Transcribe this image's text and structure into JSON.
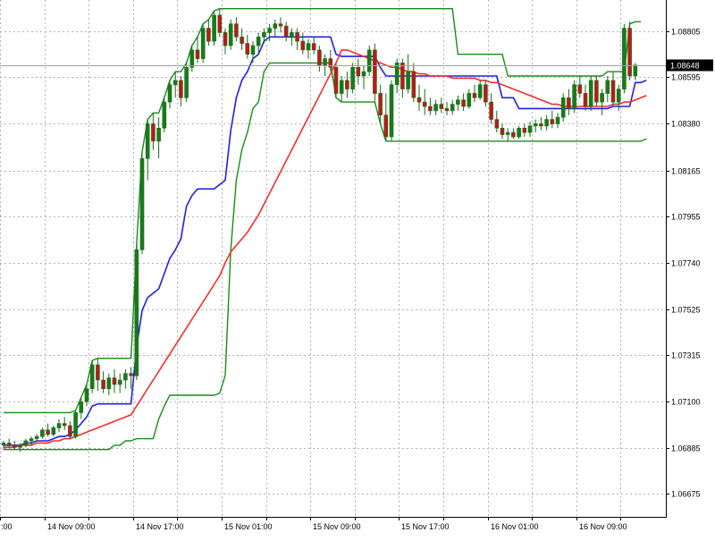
{
  "chart_data": {
    "type": "candlestick",
    "title": "",
    "grid": true,
    "ylim": [
      1.0657,
      1.0895
    ],
    "y_ticks": [
      "1.08805",
      "1.08595",
      "1.08380",
      "1.08165",
      "1.07955",
      "1.07740",
      "1.07525",
      "1.07315",
      "1.07100",
      "1.06885",
      "1.06675"
    ],
    "x_ticks": [
      "14 Nov 09:00",
      "14 Nov 17:00",
      "15 Nov 01:00",
      "15 Nov 09:00",
      "15 Nov 17:00",
      "16 Nov 01:00",
      "16 Nov 09:00"
    ],
    "x_tick_first_partial": ":00",
    "current_price": "1.08648",
    "bars_per_tick": 8,
    "ohlc": [
      [
        1.069,
        1.0692,
        1.0688,
        1.0691
      ],
      [
        1.0691,
        1.0693,
        1.0689,
        1.069
      ],
      [
        1.069,
        1.0692,
        1.0688,
        1.0689
      ],
      [
        1.0689,
        1.0691,
        1.0687,
        1.069
      ],
      [
        1.069,
        1.0693,
        1.0689,
        1.0692
      ],
      [
        1.0692,
        1.0694,
        1.069,
        1.0693
      ],
      [
        1.0693,
        1.0695,
        1.0692,
        1.0694
      ],
      [
        1.0694,
        1.0698,
        1.0693,
        1.0697
      ],
      [
        1.0697,
        1.07,
        1.0694,
        1.0695
      ],
      [
        1.0695,
        1.0699,
        1.0694,
        1.0698
      ],
      [
        1.0698,
        1.0702,
        1.0696,
        1.07
      ],
      [
        1.07,
        1.0703,
        1.0697,
        1.0699
      ],
      [
        1.0699,
        1.0701,
        1.0693,
        1.0694
      ],
      [
        1.0694,
        1.0706,
        1.0693,
        1.0705
      ],
      [
        1.0705,
        1.0712,
        1.0702,
        1.071
      ],
      [
        1.071,
        1.0718,
        1.0708,
        1.0716
      ],
      [
        1.0716,
        1.0729,
        1.0714,
        1.0727
      ],
      [
        1.0727,
        1.073,
        1.0715,
        1.072
      ],
      [
        1.072,
        1.0724,
        1.0714,
        1.0716
      ],
      [
        1.0716,
        1.0723,
        1.0713,
        1.0721
      ],
      [
        1.0721,
        1.0725,
        1.0714,
        1.0718
      ],
      [
        1.0718,
        1.0723,
        1.0714,
        1.072
      ],
      [
        1.072,
        1.0725,
        1.0716,
        1.0723
      ],
      [
        1.0723,
        1.0726,
        1.0716,
        1.0722
      ],
      [
        1.0722,
        1.0782,
        1.072,
        1.078
      ],
      [
        1.078,
        1.0825,
        1.0778,
        1.0822
      ],
      [
        1.0822,
        1.084,
        1.0812,
        1.0838
      ],
      [
        1.0838,
        1.0843,
        1.0826,
        1.083
      ],
      [
        1.083,
        1.0841,
        1.0822,
        1.0836
      ],
      [
        1.0836,
        1.085,
        1.0834,
        1.0848
      ],
      [
        1.0848,
        1.0858,
        1.0845,
        1.0856
      ],
      [
        1.0856,
        1.0862,
        1.085,
        1.0858
      ],
      [
        1.0858,
        1.086,
        1.0846,
        1.085
      ],
      [
        1.085,
        1.0866,
        1.0848,
        1.0864
      ],
      [
        1.0864,
        1.0874,
        1.0862,
        1.0872
      ],
      [
        1.0872,
        1.0878,
        1.0866,
        1.0868
      ],
      [
        1.0868,
        1.0884,
        1.0866,
        1.0882
      ],
      [
        1.0882,
        1.0886,
        1.0874,
        1.0876
      ],
      [
        1.0876,
        1.089,
        1.0874,
        1.0888
      ],
      [
        1.0888,
        1.0891,
        1.0878,
        1.088
      ],
      [
        1.088,
        1.0882,
        1.087,
        1.0874
      ],
      [
        1.0874,
        1.0886,
        1.0872,
        1.0884
      ],
      [
        1.0884,
        1.0887,
        1.0876,
        1.0878
      ],
      [
        1.0878,
        1.0882,
        1.0872,
        1.0875
      ],
      [
        1.0875,
        1.0879,
        1.0868,
        1.087
      ],
      [
        1.087,
        1.0876,
        1.0866,
        1.0874
      ],
      [
        1.0874,
        1.088,
        1.087,
        1.0878
      ],
      [
        1.0878,
        1.0882,
        1.0875,
        1.088
      ],
      [
        1.088,
        1.0884,
        1.0876,
        1.0882
      ],
      [
        1.0882,
        1.0886,
        1.0878,
        1.0884
      ],
      [
        1.0884,
        1.0887,
        1.088,
        1.0883
      ],
      [
        1.0883,
        1.0885,
        1.0876,
        1.0878
      ],
      [
        1.0878,
        1.0882,
        1.0874,
        1.088
      ],
      [
        1.088,
        1.0882,
        1.0872,
        1.0876
      ],
      [
        1.0876,
        1.088,
        1.087,
        1.0872
      ],
      [
        1.0872,
        1.0877,
        1.0868,
        1.0875
      ],
      [
        1.0875,
        1.0878,
        1.087,
        1.0872
      ],
      [
        1.0872,
        1.0874,
        1.0862,
        1.0865
      ],
      [
        1.0865,
        1.087,
        1.086,
        1.0868
      ],
      [
        1.0868,
        1.0872,
        1.0862,
        1.0864
      ],
      [
        1.0864,
        1.0866,
        1.085,
        1.0852
      ],
      [
        1.0852,
        1.086,
        1.0848,
        1.0858
      ],
      [
        1.0858,
        1.0862,
        1.085,
        1.0854
      ],
      [
        1.0854,
        1.0866,
        1.0852,
        1.0864
      ],
      [
        1.0864,
        1.0868,
        1.0856,
        1.086
      ],
      [
        1.086,
        1.0865,
        1.0854,
        1.0862
      ],
      [
        1.0862,
        1.0874,
        1.086,
        1.0872
      ],
      [
        1.0872,
        1.0875,
        1.0848,
        1.0852
      ],
      [
        1.0852,
        1.0856,
        1.0838,
        1.0842
      ],
      [
        1.0842,
        1.0852,
        1.083,
        1.0832
      ],
      [
        1.0832,
        1.0858,
        1.083,
        1.0856
      ],
      [
        1.0856,
        1.0868,
        1.0852,
        1.0866
      ],
      [
        1.0866,
        1.0868,
        1.085,
        1.0854
      ],
      [
        1.0854,
        1.087,
        1.0852,
        1.0862
      ],
      [
        1.0862,
        1.0866,
        1.0848,
        1.085
      ],
      [
        1.085,
        1.0856,
        1.0844,
        1.0848
      ],
      [
        1.0848,
        1.0854,
        1.0842,
        1.0846
      ],
      [
        1.0846,
        1.085,
        1.0842,
        1.0844
      ],
      [
        1.0844,
        1.0849,
        1.0842,
        1.0847
      ],
      [
        1.0847,
        1.085,
        1.0843,
        1.0845
      ],
      [
        1.0845,
        1.0848,
        1.0842,
        1.0844
      ],
      [
        1.0844,
        1.0849,
        1.0842,
        1.0847
      ],
      [
        1.0847,
        1.0851,
        1.0844,
        1.0849
      ],
      [
        1.0849,
        1.0852,
        1.0844,
        1.0846
      ],
      [
        1.0846,
        1.0854,
        1.0845,
        1.0852
      ],
      [
        1.0852,
        1.0856,
        1.0848,
        1.085
      ],
      [
        1.085,
        1.0858,
        1.0849,
        1.0856
      ],
      [
        1.0856,
        1.0858,
        1.0846,
        1.0848
      ],
      [
        1.0848,
        1.0852,
        1.0838,
        1.084
      ],
      [
        1.084,
        1.0844,
        1.0834,
        1.0836
      ],
      [
        1.0836,
        1.0838,
        1.0831,
        1.0833
      ],
      [
        1.0833,
        1.0836,
        1.083,
        1.0834
      ],
      [
        1.0834,
        1.0836,
        1.0831,
        1.0832
      ],
      [
        1.0832,
        1.0837,
        1.0831,
        1.0836
      ],
      [
        1.0836,
        1.0838,
        1.0832,
        1.0834
      ],
      [
        1.0834,
        1.0839,
        1.0832,
        1.0837
      ],
      [
        1.0837,
        1.084,
        1.0834,
        1.0838
      ],
      [
        1.0838,
        1.0841,
        1.0835,
        1.0837
      ],
      [
        1.0837,
        1.0842,
        1.0835,
        1.084
      ],
      [
        1.084,
        1.0844,
        1.0836,
        1.0838
      ],
      [
        1.0838,
        1.0843,
        1.0836,
        1.0841
      ],
      [
        1.0841,
        1.0852,
        1.0839,
        1.085
      ],
      [
        1.085,
        1.0854,
        1.0842,
        1.0845
      ],
      [
        1.0845,
        1.0858,
        1.0843,
        1.0856
      ],
      [
        1.0856,
        1.086,
        1.085,
        1.0852
      ],
      [
        1.0852,
        1.0856,
        1.0844,
        1.0846
      ],
      [
        1.0846,
        1.086,
        1.0844,
        1.0858
      ],
      [
        1.0858,
        1.086,
        1.0846,
        1.0848
      ],
      [
        1.0848,
        1.0854,
        1.0842,
        1.0852
      ],
      [
        1.0852,
        1.086,
        1.0848,
        1.0858
      ],
      [
        1.0858,
        1.0862,
        1.0846,
        1.0848
      ],
      [
        1.0848,
        1.0856,
        1.0844,
        1.0854
      ],
      [
        1.0854,
        1.0884,
        1.0852,
        1.0882
      ],
      [
        1.0882,
        1.0885,
        1.0858,
        1.086
      ],
      [
        1.086,
        1.0866,
        1.0858,
        1.0865
      ]
    ],
    "series": [
      {
        "color": "#1a8a1a",
        "type": "channel_upper",
        "values": [
          1.0705,
          1.0705,
          1.0705,
          1.0705,
          1.0705,
          1.0705,
          1.0705,
          1.0705,
          1.0705,
          1.0705,
          1.0705,
          1.0705,
          1.0705,
          1.0706,
          1.0712,
          1.0718,
          1.0729,
          1.073,
          1.073,
          1.073,
          1.073,
          1.073,
          1.073,
          1.073,
          1.0782,
          1.0825,
          1.084,
          1.0843,
          1.0843,
          1.085,
          1.0858,
          1.0862,
          1.0862,
          1.0866,
          1.0874,
          1.0878,
          1.0884,
          1.0886,
          1.089,
          1.0891,
          1.0891,
          1.0891,
          1.0891,
          1.0891,
          1.0891,
          1.0891,
          1.0891,
          1.0891,
          1.0891,
          1.0891,
          1.0891,
          1.0891,
          1.0891,
          1.0891,
          1.0891,
          1.0891,
          1.0891,
          1.0891,
          1.0891,
          1.0891,
          1.0891,
          1.0891,
          1.0891,
          1.0891,
          1.0891,
          1.0891,
          1.0891,
          1.0891,
          1.0891,
          1.0891,
          1.0891,
          1.0891,
          1.0891,
          1.0891,
          1.0891,
          1.0891,
          1.0891,
          1.0891,
          1.0891,
          1.0891,
          1.0891,
          1.0891,
          1.087,
          1.087,
          1.087,
          1.087,
          1.087,
          1.087,
          1.087,
          1.087,
          1.087,
          1.086,
          1.086,
          1.086,
          1.086,
          1.086,
          1.086,
          1.086,
          1.086,
          1.086,
          1.086,
          1.086,
          1.086,
          1.086,
          1.086,
          1.086,
          1.086,
          1.086,
          1.086,
          1.0862,
          1.0862,
          1.0862,
          1.0862,
          1.0884,
          1.0885,
          1.0885
        ]
      },
      {
        "color": "#1a8a1a",
        "type": "channel_lower",
        "values": [
          1.0688,
          1.0688,
          1.0688,
          1.0688,
          1.0688,
          1.0688,
          1.0688,
          1.0688,
          1.0688,
          1.0688,
          1.0688,
          1.0688,
          1.0688,
          1.0688,
          1.0688,
          1.0688,
          1.0688,
          1.0688,
          1.0688,
          1.0688,
          1.069,
          1.069,
          1.0692,
          1.0692,
          1.0693,
          1.0693,
          1.0693,
          1.0693,
          1.0702,
          1.0708,
          1.0713,
          1.0713,
          1.0713,
          1.0713,
          1.0713,
          1.0713,
          1.0713,
          1.0713,
          1.0713,
          1.0714,
          1.0722,
          1.078,
          1.0812,
          1.0826,
          1.0834,
          1.0845,
          1.0848,
          1.0862,
          1.0866,
          1.0866,
          1.0866,
          1.0866,
          1.0866,
          1.0866,
          1.0866,
          1.0866,
          1.0866,
          1.0866,
          1.0866,
          1.0866,
          1.085,
          1.0848,
          1.0848,
          1.0848,
          1.0848,
          1.0848,
          1.0848,
          1.0848,
          1.0838,
          1.083,
          1.083,
          1.083,
          1.083,
          1.083,
          1.083,
          1.083,
          1.083,
          1.083,
          1.083,
          1.083,
          1.083,
          1.083,
          1.083,
          1.083,
          1.083,
          1.083,
          1.083,
          1.083,
          1.083,
          1.083,
          1.083,
          1.083,
          1.083,
          1.083,
          1.083,
          1.083,
          1.083,
          1.083,
          1.083,
          1.083,
          1.083,
          1.083,
          1.083,
          1.083,
          1.083,
          1.083,
          1.083,
          1.083,
          1.083,
          1.083,
          1.083,
          1.083,
          1.083,
          1.083,
          1.083,
          1.083,
          1.0831
        ]
      },
      {
        "color": "#2020e0",
        "type": "line",
        "values": [
          1.069,
          1.069,
          1.069,
          1.069,
          1.0691,
          1.0691,
          1.0692,
          1.0692,
          1.0692,
          1.0693,
          1.0694,
          1.0694,
          1.0695,
          1.0697,
          1.07,
          1.0703,
          1.0708,
          1.0709,
          1.0709,
          1.0709,
          1.0709,
          1.0709,
          1.0709,
          1.0709,
          1.0735,
          1.0752,
          1.0758,
          1.076,
          1.0762,
          1.0769,
          1.0776,
          1.078,
          1.0785,
          1.08,
          1.0805,
          1.0808,
          1.0808,
          1.0808,
          1.0808,
          1.081,
          1.0812,
          1.0835,
          1.085,
          1.0858,
          1.0862,
          1.0868,
          1.087,
          1.0876,
          1.0878,
          1.0878,
          1.0878,
          1.0878,
          1.0878,
          1.0878,
          1.0878,
          1.0878,
          1.0878,
          1.0878,
          1.0878,
          1.0878,
          1.087,
          1.0869,
          1.0869,
          1.0869,
          1.0869,
          1.0869,
          1.0869,
          1.0869,
          1.0864,
          1.086,
          1.086,
          1.086,
          1.086,
          1.086,
          1.086,
          1.086,
          1.086,
          1.086,
          1.086,
          1.086,
          1.086,
          1.086,
          1.086,
          1.086,
          1.086,
          1.086,
          1.086,
          1.086,
          1.086,
          1.086,
          1.085,
          1.085,
          1.085,
          1.0845,
          1.0845,
          1.0845,
          1.0845,
          1.0845,
          1.0845,
          1.0845,
          1.0845,
          1.0845,
          1.0845,
          1.0845,
          1.0845,
          1.0845,
          1.0845,
          1.0845,
          1.0845,
          1.0845,
          1.0846,
          1.0846,
          1.0846,
          1.0846,
          1.0857,
          1.0857,
          1.0858
        ]
      },
      {
        "color": "#ee3030",
        "type": "line",
        "values": [
          1.0689,
          1.0689,
          1.0689,
          1.069,
          1.069,
          1.069,
          1.0691,
          1.0691,
          1.0691,
          1.0692,
          1.0692,
          1.0693,
          1.0693,
          1.0694,
          1.0695,
          1.0696,
          1.0697,
          1.0698,
          1.0699,
          1.07,
          1.0701,
          1.0702,
          1.0703,
          1.0704,
          1.0708,
          1.0712,
          1.0716,
          1.072,
          1.0724,
          1.0728,
          1.0732,
          1.0736,
          1.074,
          1.0744,
          1.0748,
          1.0752,
          1.0756,
          1.076,
          1.0764,
          1.0768,
          1.0774,
          1.0779,
          1.0782,
          1.0785,
          1.0788,
          1.0792,
          1.0796,
          1.0801,
          1.0806,
          1.0811,
          1.0816,
          1.0821,
          1.0826,
          1.0831,
          1.0836,
          1.0841,
          1.0846,
          1.0851,
          1.0856,
          1.0861,
          1.0866,
          1.0872,
          1.0872,
          1.0871,
          1.087,
          1.0869,
          1.0868,
          1.0867,
          1.0866,
          1.0865,
          1.0864,
          1.0864,
          1.0863,
          1.0862,
          1.0862,
          1.0861,
          1.0861,
          1.086,
          1.086,
          1.086,
          1.086,
          1.0859,
          1.0859,
          1.0859,
          1.0859,
          1.0859,
          1.0858,
          1.0858,
          1.0857,
          1.0857,
          1.0856,
          1.0855,
          1.0854,
          1.0853,
          1.0852,
          1.0851,
          1.085,
          1.0849,
          1.0848,
          1.0847,
          1.0847,
          1.0846,
          1.0846,
          1.0846,
          1.0846,
          1.0846,
          1.0846,
          1.0846,
          1.0846,
          1.0846,
          1.0847,
          1.0847,
          1.0848,
          1.0848,
          1.0849,
          1.085,
          1.0851
        ]
      }
    ]
  }
}
